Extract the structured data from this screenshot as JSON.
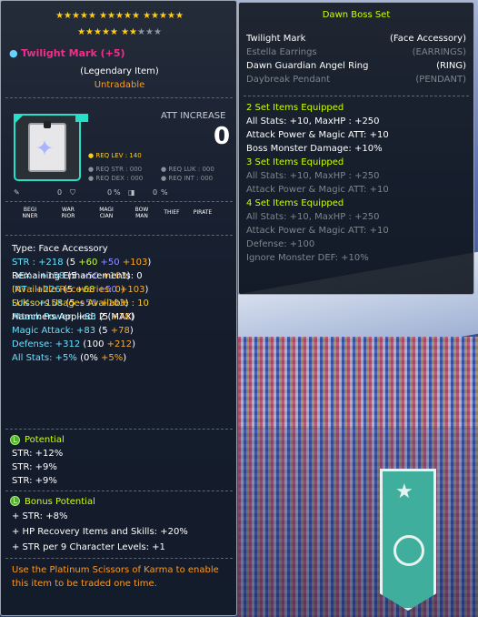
{
  "item": {
    "stars_row1": "★★★★★ ★★★★★ ★★★★★",
    "stars_row2_lit": "★★★★★ ★★",
    "stars_row2_dim": "★★★",
    "name": "Twilight Mark (+5)",
    "rarity": "(Legendary Item)",
    "trade": "Untradable",
    "att_increase_label": "ATT INCREASE",
    "att_increase_value": "0",
    "req_lev": "REQ LEV : 140",
    "req_str": "REQ STR : 000",
    "req_luk": "REQ LUK : 000",
    "req_dex": "REQ DEX : 000",
    "req_int": "REQ INT : 000",
    "icon_values": [
      "0",
      "0",
      "0",
      "0"
    ],
    "icon_percent": [
      "%",
      "%"
    ],
    "classes": [
      "BEGI\nNNER",
      "WAR\nRIOR",
      "MAGI\nCIAN",
      "BOW\nMAN",
      "THIEF",
      "PIRATE"
    ],
    "type": "Type: Face Accessory",
    "stats": [
      {
        "label": "STR : ",
        "total": "+218",
        "open": " (",
        "base": "5",
        "p1": " +60",
        "p2": " +50",
        "p3": " +103",
        "close": ")"
      },
      {
        "label": "DEX : ",
        "total": "+158",
        "open": " (",
        "base": "5",
        "p2": " +50",
        "p3": " +103",
        "close": ")"
      },
      {
        "label": "INT : ",
        "total": "+226",
        "open": " (",
        "base": "5",
        "p1": " +68",
        "p2": " +50",
        "p3": " +103",
        "close": ")"
      },
      {
        "label": "LUK : ",
        "total": "+158",
        "open": " (",
        "base": "5",
        "p2": " +50",
        "p3": " +103",
        "close": ")"
      },
      {
        "label": "Attack Power: ",
        "total": "+83",
        "open": " (",
        "base": "5",
        "p3": " +78",
        "close": ")"
      },
      {
        "label": "Magic Attack: ",
        "total": "+83",
        "open": " (",
        "base": "5",
        "p3": " +78",
        "close": ")"
      },
      {
        "label": "Defense: ",
        "total": "+312",
        "open": " (",
        "base": "100",
        "p3": " +212",
        "close": ")"
      },
      {
        "label": "All Stats: ",
        "total": "+5%",
        "open": " (",
        "base": "0%",
        "p3": " +5%",
        "close": ")"
      }
    ],
    "remaining": "Remaining Enhancements: 0",
    "recoveries": "(Available Recoveries: 0)",
    "scissors": "Scissors Usages Available : 10",
    "hammers": "Hammers Applied: 2 (MAX)",
    "potential_title": "Potential",
    "potential": [
      "STR: +12%",
      "STR: +9%",
      "STR: +9%"
    ],
    "bonus_title": "Bonus Potential",
    "bonus": [
      "+ STR: +8%",
      "+ HP Recovery Items and Skills: +20%",
      "+ STR per 9 Character Levels: +1"
    ],
    "karma_text": "Use the Platinum Scissors of Karma to enable this item to be traded one time.",
    "potential_icon": "L",
    "bonus_icon": "L"
  },
  "set": {
    "name": "Dawn Boss Set",
    "pieces": [
      {
        "name": "Twilight Mark",
        "type": "(Face Accessory)",
        "owned": true
      },
      {
        "name": "Estella Earrings",
        "type": "(EARRINGS)",
        "owned": false
      },
      {
        "name": "Dawn Guardian Angel Ring",
        "type": "(RING)",
        "owned": true
      },
      {
        "name": "Daybreak Pendant",
        "type": "(PENDANT)",
        "owned": false
      }
    ],
    "bonuses": [
      {
        "text": "2 Set Items Equipped",
        "kind": "head"
      },
      {
        "text": "All Stats: +10, MaxHP : +250",
        "kind": "on"
      },
      {
        "text": "Attack Power & Magic ATT: +10",
        "kind": "on"
      },
      {
        "text": "Boss Monster Damage: +10%",
        "kind": "on"
      },
      {
        "text": "3 Set Items Equipped",
        "kind": "head"
      },
      {
        "text": "All Stats: +10, MaxHP : +250",
        "kind": "off"
      },
      {
        "text": "Attack Power & Magic ATT: +10",
        "kind": "off"
      },
      {
        "text": "4 Set Items Equipped",
        "kind": "head"
      },
      {
        "text": "All Stats: +10, MaxHP : +250",
        "kind": "off"
      },
      {
        "text": "Attack Power & Magic ATT: +10",
        "kind": "off"
      },
      {
        "text": "Defense: +100",
        "kind": "off"
      },
      {
        "text": "Ignore Monster DEF: +10%",
        "kind": "off"
      }
    ]
  },
  "colors": {
    "title": "#f22d8b",
    "cyan": "#66e0ff",
    "green": "#c0ff33",
    "blue": "#8f8fff",
    "orange": "#ffaa22",
    "setgreen": "#ccff00"
  }
}
